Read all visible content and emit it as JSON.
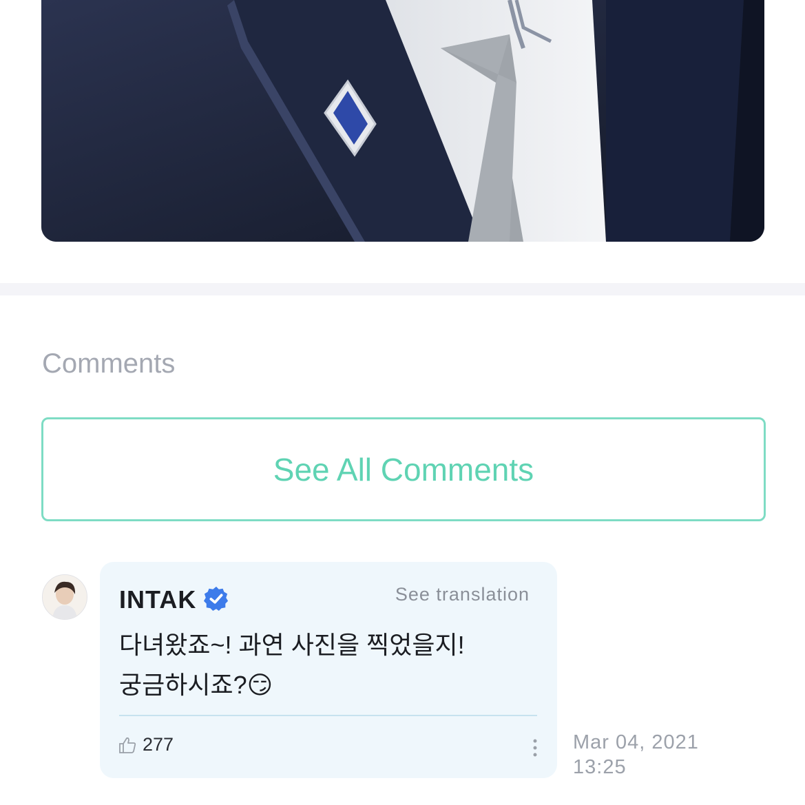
{
  "post": {
    "image_alt": "photo-jacket-pin"
  },
  "comments": {
    "heading": "Comments",
    "see_all_label": "See All Comments",
    "accent_color": "#5fd3b3",
    "items": [
      {
        "author": "INTAK",
        "verified": true,
        "see_translation_label": "See translation",
        "text": "다녀왔죠~! 과연 사진을 찍었을지!\n궁금하시죠?😏",
        "likes": "277",
        "date": "Mar 04, 2021",
        "time": "13:25"
      }
    ]
  },
  "icons": {
    "verified": "verified-badge-icon",
    "like": "thumbs-up-icon",
    "more": "more-vertical-icon"
  }
}
